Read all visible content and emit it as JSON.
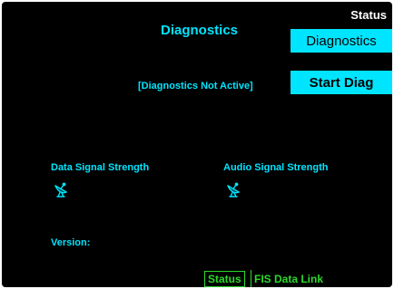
{
  "colors": {
    "background": "#000000",
    "cyan": "#00e5ff",
    "green": "#2bd92b",
    "white": "#ffffff"
  },
  "header": {
    "page_label": "Status",
    "title": "Diagnostics"
  },
  "softkeys": {
    "diagnostics": "Diagnostics",
    "start_diag": "Start Diag"
  },
  "status": {
    "message": "[Diagnostics Not Active]"
  },
  "signals": {
    "data_label": "Data Signal Strength",
    "data_icon": "satellite-dish-icon",
    "audio_label": "Audio Signal Strength",
    "audio_icon": "satellite-dish-icon"
  },
  "version": {
    "label": "Version:",
    "value": ""
  },
  "footer": {
    "status_button": "Status",
    "link_name": "FIS Data Link"
  }
}
